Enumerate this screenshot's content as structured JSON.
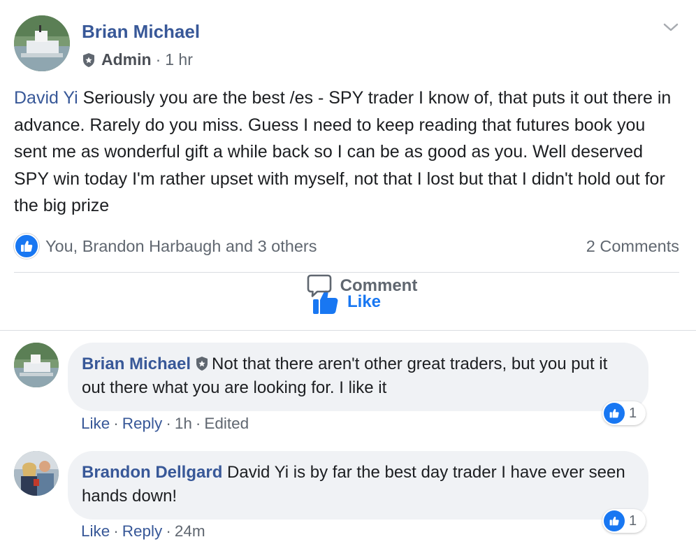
{
  "post": {
    "author": "Brian Michael",
    "role": "Admin",
    "time": "1 hr",
    "mention": "David Yi",
    "body": " Seriously you are the best /es - SPY trader I know of, that puts it out there in advance. Rarely do you miss. Guess I need to keep reading that futures book you sent me as wonderful gift a while back so I can be as good as you. Well deserved SPY win today I'm rather upset with myself, not that I lost but that I didn't hold out for the big prize",
    "reactions_text": "You, Brandon Harbaugh and 3 others",
    "comments_count": "2 Comments"
  },
  "actions": {
    "like_label": "Like",
    "comment_label": "Comment"
  },
  "comments": [
    {
      "author": "Brian Michael",
      "text": "Not that there aren't other great traders, but you put it out there what you are looking for. I like it",
      "like_label": "Like",
      "reply_label": "Reply",
      "time": "1h",
      "edited": "Edited",
      "reaction_count": "1"
    },
    {
      "author": "Brandon Dellgard",
      "text": "David Yi is by far the best day trader I have ever seen hands down!",
      "like_label": "Like",
      "reply_label": "Reply",
      "time": "24m",
      "reaction_count": "1"
    }
  ],
  "separators": {
    "dot": "·"
  },
  "colors": {
    "name_blue": "#385898",
    "like_blue": "#1877f2",
    "muted": "#606770",
    "bubble": "#f0f2f5",
    "divider": "#dadde1"
  },
  "icons": {
    "admin_badge": "shield-star-icon",
    "chevron": "chevron-down-icon",
    "like": "thumbs-up-icon",
    "comment": "speech-bubble-icon"
  }
}
